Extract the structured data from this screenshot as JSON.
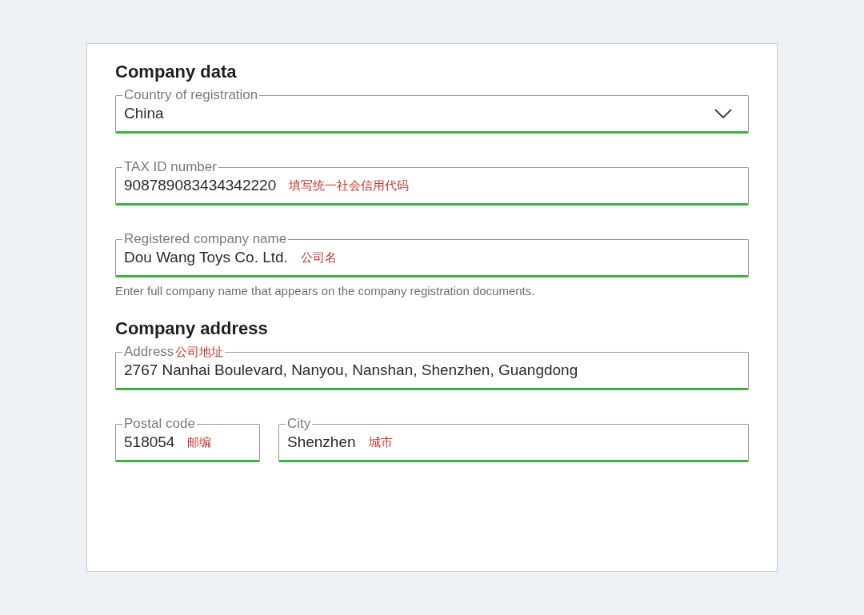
{
  "sections": [
    {
      "title": "Company data",
      "rows": [
        [
          {
            "kind": "select",
            "label": "Country of registration",
            "value": "China"
          }
        ],
        [
          {
            "kind": "text",
            "label": "TAX ID number",
            "value": "908789083434342220",
            "note": "填写统一社会信用代码"
          }
        ],
        [
          {
            "kind": "text",
            "label": "Registered company name",
            "value": "Dou Wang Toys Co. Ltd.",
            "note": "公司名",
            "help": "Enter full company name that appears on the company registration documents."
          }
        ]
      ]
    },
    {
      "title": "Company address",
      "rows": [
        [
          {
            "kind": "text",
            "label": "Address",
            "label_note": "公司地址",
            "value": "2767 Nanhai Boulevard, Nanyou, Nanshan, Shenzhen, Guangdong"
          }
        ],
        [
          {
            "kind": "text",
            "label": "Postal code",
            "value": "518054",
            "note": "邮编"
          },
          {
            "kind": "text",
            "label": "City",
            "value": "Shenzhen",
            "note": "城市"
          }
        ]
      ]
    }
  ]
}
